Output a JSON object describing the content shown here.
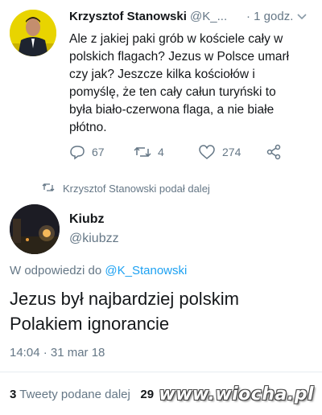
{
  "quoted_tweet": {
    "author_name": "Krzysztof Stanowski",
    "author_handle": "@K_...",
    "time": "· 1 godz.",
    "text": "Ale z jakiej paki grób w kościele cały w\npolskich flagach? Jezus w Polsce umarł\nczy jak? Jeszcze kilka kościołów i\npomyślę, że ten cały całun turyński to\nbyła biało-czerwona flaga, a nie białe\npłótno.",
    "replies": "67",
    "retweets": "4",
    "likes": "274"
  },
  "retweet_notice": "Krzysztof Stanowski podał dalej",
  "main_tweet": {
    "author_name": "Kiubz",
    "author_handle": "@kiubzz",
    "reply_prefix": "W odpowiedzi do",
    "reply_mention": "@K_Stanowski",
    "text": "Jezus był najbardziej polskim\nPolakiem ignorancie",
    "timestamp": "14:04 · 31 mar 18",
    "retweet_count": "3",
    "retweet_label": "Tweety podane dalej",
    "like_count": "29"
  },
  "watermark": "www.wiocha.pl",
  "colors": {
    "accent": "#1da1f2",
    "secondary_text": "#657786",
    "avatar_yellow": "#e8d400"
  },
  "icons": [
    "chevron-down-icon",
    "reply-icon",
    "retweet-icon",
    "like-icon",
    "share-icon",
    "retweet-notice-icon"
  ]
}
